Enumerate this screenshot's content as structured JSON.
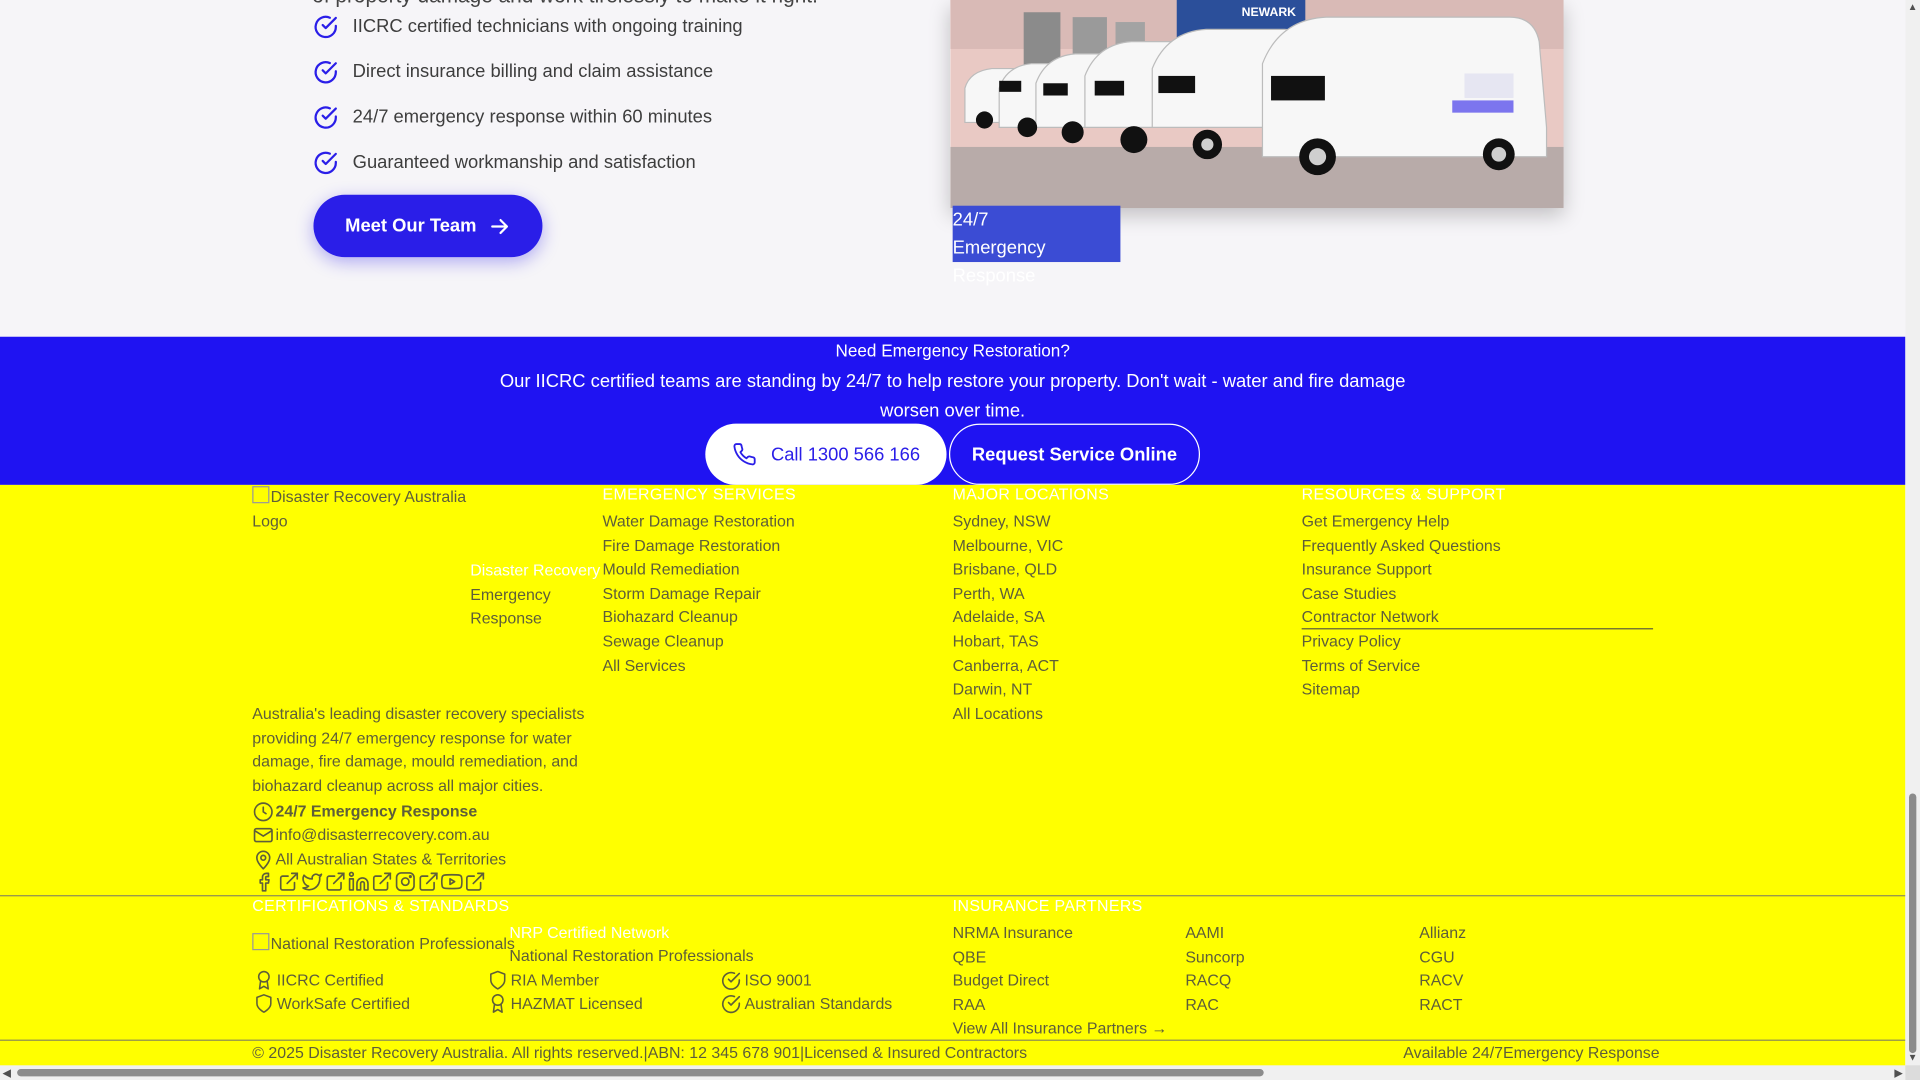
{
  "about": {
    "intro_tail": "of property damage and work tirelessly to make it right.",
    "checklist": [
      "IICRC certified technicians with ongoing training",
      "Direct insurance billing and claim assistance",
      "24/7 emergency response within 60 minutes",
      "Guaranteed workmanship and satisfaction"
    ],
    "meet_team_label": "Meet Our Team",
    "photo_sign_text": "NEWARK",
    "badge_line1": "24/7",
    "badge_line2": "Emergency Response"
  },
  "cta": {
    "title": "Need Emergency Restoration?",
    "description": "Our IICRC certified teams are standing by 24/7 to help restore your property. Don't wait - water and fire damage worsen over time.",
    "call_label": "Call 1300 566 166",
    "request_label": "Request Service Online"
  },
  "footer": {
    "logo_alt": "Disaster Recovery Australia Logo",
    "brand_line1": "Disaster Recovery",
    "brand_line2": "Emergency",
    "brand_line3": "Response",
    "description": "Australia's leading disaster recovery specialists providing 24/7 emergency response for water damage, fire damage, mould remediation, and biohazard cleanup across all major cities.",
    "contact": {
      "emergency": "24/7 Emergency Response",
      "email": "info@disasterrecovery.com.au",
      "area": "All Australian States & Territories"
    },
    "social_icons": [
      "facebook-icon",
      "twitter-icon",
      "linkedin-icon",
      "instagram-icon",
      "youtube-icon"
    ],
    "services": {
      "heading": "EMERGENCY SERVICES",
      "items": [
        "Water Damage Restoration",
        "Fire Damage Restoration",
        "Mould Remediation",
        "Storm Damage Repair",
        "Biohazard Cleanup",
        "Sewage Cleanup",
        "All Services"
      ]
    },
    "locations": {
      "heading": "MAJOR LOCATIONS",
      "items": [
        "Sydney, NSW",
        "Melbourne, VIC",
        "Brisbane, QLD",
        "Perth, WA",
        "Adelaide, SA",
        "Hobart, TAS",
        "Canberra, ACT",
        "Darwin, NT",
        "All Locations"
      ]
    },
    "resources": {
      "heading": "RESOURCES & SUPPORT",
      "items": [
        "Get Emergency Help",
        "Frequently Asked Questions",
        "Insurance Support",
        "Case Studies",
        "Contractor Network",
        "Privacy Policy",
        "Terms of Service",
        "Sitemap"
      ]
    },
    "certifications": {
      "heading": "CERTIFICATIONS & STANDARDS",
      "nrp_alt": "National Restoration Professionals",
      "nrp_title": "NRP Certified Network",
      "nrp_subtitle": "National Restoration Professionals",
      "badges": [
        "IICRC Certified",
        "RIA Member",
        "ISO 9001",
        "WorkSafe Certified",
        "HAZMAT Licensed",
        "Australian Standards"
      ]
    },
    "insurance": {
      "heading": "INSURANCE PARTNERS",
      "col1": [
        "NRMA Insurance",
        "QBE",
        "Budget Direct",
        "RAA"
      ],
      "col2": [
        "AAMI",
        "Suncorp",
        "RACQ",
        "RAC"
      ],
      "col3": [
        "Allianz",
        "CGU",
        "RACV",
        "RACT"
      ],
      "view_all": "View All Insurance Partners →"
    },
    "bottom": {
      "copyright": "© 2025 Disaster Recovery Australia. All rights reserved.",
      "sep": "|",
      "abn": "ABN: 12 345 678 901",
      "licensed": "Licensed & Insured Contractors",
      "available": "Available 24/7",
      "emergency": "Emergency Response"
    }
  },
  "colors": {
    "accent_blue": "#2a1ee8",
    "cta_background": "#1f13f2",
    "footer_background": "#ffff00"
  }
}
